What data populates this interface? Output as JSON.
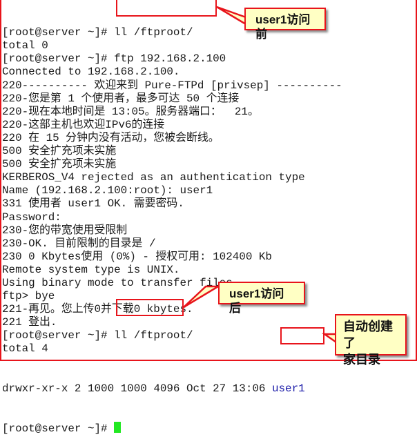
{
  "terminal": {
    "prompt": "[root@server ~]# ",
    "lines": [
      {
        "text": "[root@server ~]# ll /ftproot/"
      },
      {
        "text": "total 0"
      },
      {
        "text": "[root@server ~]# ftp 192.168.2.100"
      },
      {
        "text": "Connected to 192.168.2.100."
      },
      {
        "text": "220---------- 欢迎来到 Pure-FTPd [privsep] ----------"
      },
      {
        "text": "220-您是第 1 个使用者，最多可达 50 个连接"
      },
      {
        "text": "220-现在本地时间是 13:05。服务器端口：  21。"
      },
      {
        "text": "220-这部主机也欢迎IPv6的连接"
      },
      {
        "text": "220 在 15 分钟内没有活动，您被会断线。"
      },
      {
        "text": "500 安全扩充项未实施"
      },
      {
        "text": "500 安全扩充项未实施"
      },
      {
        "text": "KERBEROS_V4 rejected as an authentication type"
      },
      {
        "text": "Name (192.168.2.100:root): user1"
      },
      {
        "text": "331 使用者 user1 OK. 需要密码."
      },
      {
        "text": "Password:"
      },
      {
        "text": "230-您的带宽使用受限制"
      },
      {
        "text": "230-OK. 目前限制的目录是 /"
      },
      {
        "text": "230 0 Kbytes使用 (0%) - 授权可用: 102400 Kb"
      },
      {
        "text": "Remote system type is UNIX."
      },
      {
        "text": "Using binary mode to transfer files."
      },
      {
        "text": "ftp> bye"
      },
      {
        "text": "221-再见。您上传0并下载0 kbytes."
      },
      {
        "text": "221 登出."
      },
      {
        "text": "[root@server ~]# ll /ftproot/"
      },
      {
        "text": "total 4"
      }
    ],
    "listing": {
      "perms": "drwxr-xr-x 2 1000 1000 4096 Oct 27 13:06 ",
      "name": "user1"
    },
    "final_prompt": "[root@server ~]# "
  },
  "callouts": {
    "before": "user1访问前",
    "after": "user1访问后",
    "auto_created_line1": "自动创建了",
    "auto_created_line2": "家目录"
  },
  "colors": {
    "highlight": "#e8141b",
    "callout_bg": "#ffffc4",
    "cursor": "#22e822",
    "directory": "#1a1aa8"
  }
}
